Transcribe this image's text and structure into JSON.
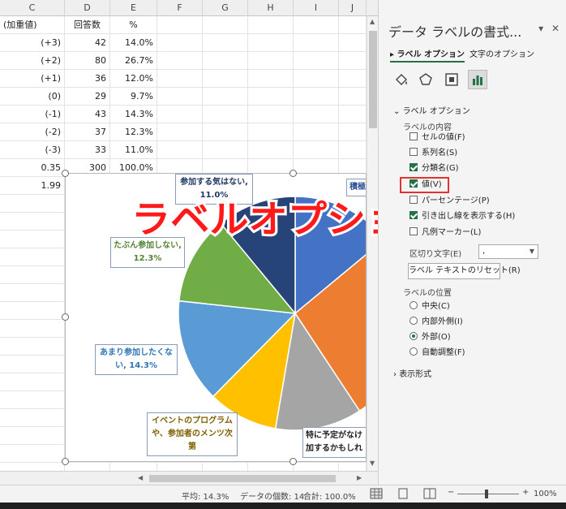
{
  "sheet": {
    "columns": [
      "C",
      "D",
      "E",
      "F",
      "G",
      "H",
      "I",
      "J"
    ],
    "rows": [
      [
        "(加重値)",
        "回答数",
        "%"
      ],
      [
        "(+3)",
        "42",
        "14.0%"
      ],
      [
        "(+2)",
        "80",
        "26.7%"
      ],
      [
        "(+1)",
        "36",
        "12.0%"
      ],
      [
        "(0)",
        "29",
        "9.7%"
      ],
      [
        "(-1)",
        "43",
        "14.3%"
      ],
      [
        "(-2)",
        "37",
        "12.3%"
      ],
      [
        "(-3)",
        "33",
        "11.0%"
      ],
      [
        "0.35",
        "300",
        "100.0%"
      ],
      [
        "1.99",
        "",
        ""
      ]
    ]
  },
  "chart_data": {
    "type": "pie",
    "start_angle_deg": 0,
    "categories": [
      "積極的に参加したい",
      "",
      "",
      "特に予定がなければ参加するかもしれない",
      "イベントのプログラムや、参加者のメンツ次第",
      "あまり参加したくない",
      "たぶん参加しない",
      "参加する気はない"
    ],
    "values": [
      14.0,
      26.7,
      12.0,
      9.7,
      14.3,
      12.3,
      11.0
    ],
    "colors": [
      "#4472c4",
      "#ed7d31",
      "#a5a5a5",
      "#ffc000",
      "#5b9bd5",
      "#70ad47",
      "#264478"
    ],
    "data_labels": [
      {
        "line1": "参加する気はない,",
        "line2": "11.0%",
        "color": "#1f3864"
      },
      {
        "line1": "たぶん参加しない,",
        "line2": "12.3%",
        "color": "#548235"
      },
      {
        "line1": "あまり参加したくな",
        "line2": "い, 14.3%",
        "color": "#2e75b6"
      },
      {
        "line1": "イベントのプログラム",
        "line2": "や、参加者のメンツ次",
        "line3": "第",
        "color": "#7f6000"
      },
      {
        "line1": "特に予定がなけ",
        "line2": "加するかもしれ",
        "color": "#222222"
      },
      {
        "line1": "積極",
        "color": "#2f5597"
      }
    ]
  },
  "overlay_text": "ラベルオプションで値を",
  "pane": {
    "title": "データ ラベルの書式...",
    "tabs": [
      "ラベル オプション",
      "文字のオプション"
    ],
    "section": "ラベル オプション",
    "contents_label": "ラベルの内容",
    "checkboxes": [
      {
        "label": "セルの値(F)",
        "checked": false
      },
      {
        "label": "系列名(S)",
        "checked": false
      },
      {
        "label": "分類名(G)",
        "checked": true
      },
      {
        "label": "値(V)",
        "checked": true
      },
      {
        "label": "パーセンテージ(P)",
        "checked": false
      },
      {
        "label": "引き出し線を表示する(H)",
        "checked": true
      },
      {
        "label": "凡例マーカー(L)",
        "checked": false
      }
    ],
    "separator_label": "区切り文字(E)",
    "separator_value": ",",
    "reset_button": "ラベル テキストのリセット(R)",
    "position_label": "ラベルの位置",
    "positions": [
      {
        "label": "中央(C)",
        "selected": false
      },
      {
        "label": "内部外側(I)",
        "selected": false
      },
      {
        "label": "外部(O)",
        "selected": true
      },
      {
        "label": "自動調整(F)",
        "selected": false
      }
    ],
    "format_section": "表示形式"
  },
  "status": {
    "average": "平均: 14.3%",
    "count": "データの個数: 14",
    "sum": "合計: 100.0%",
    "zoom": "100%"
  }
}
